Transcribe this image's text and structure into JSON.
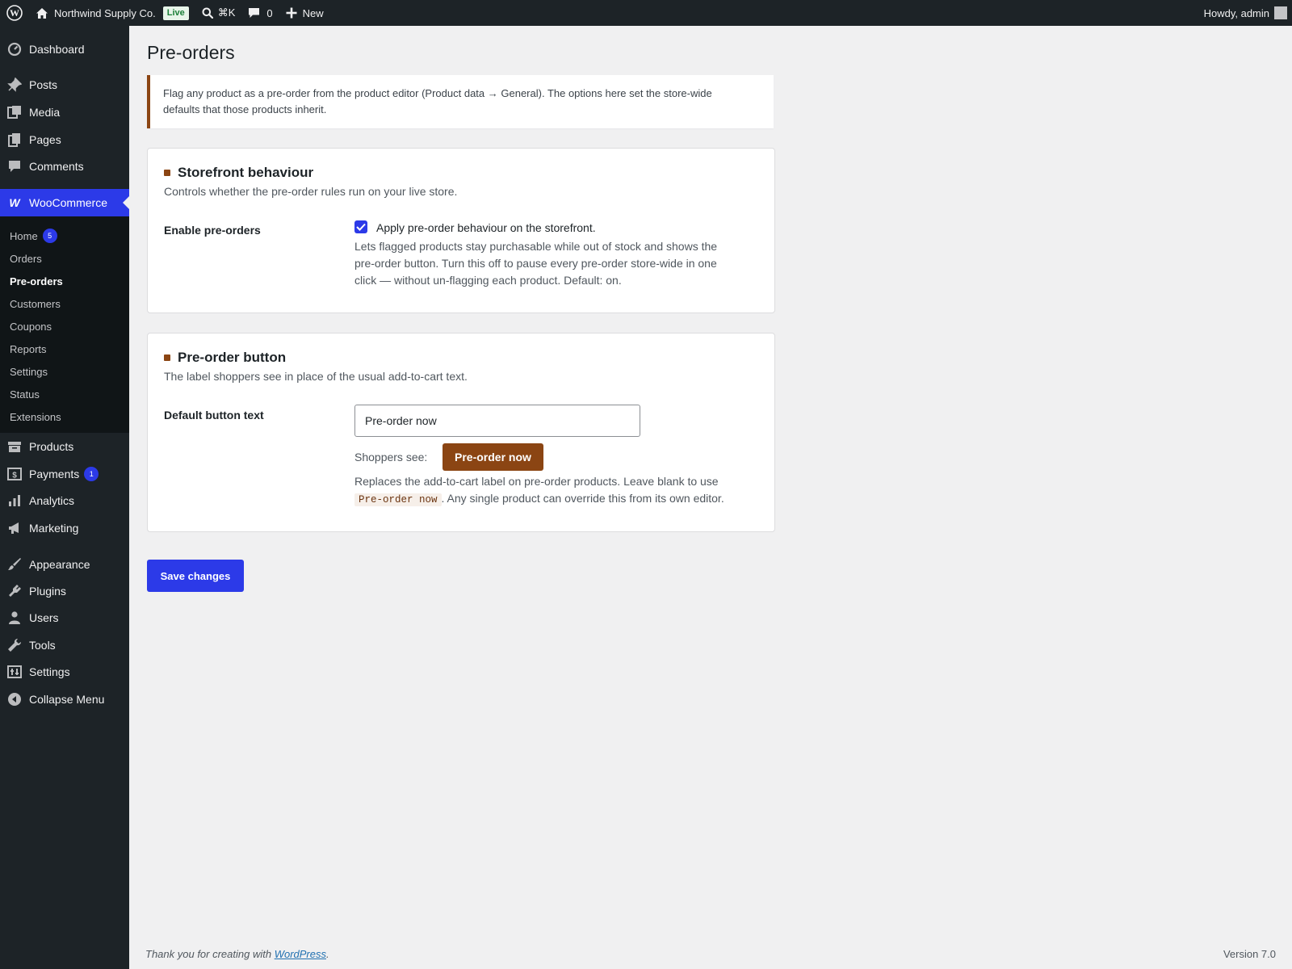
{
  "adminbar": {
    "site_name": "Northwind Supply Co.",
    "live_badge": "Live",
    "search_shortcut": "⌘K",
    "comments_count": "0",
    "new_label": "New",
    "greeting": "Howdy, admin"
  },
  "sidebar": {
    "items": [
      {
        "label": "Dashboard",
        "icon": "dashboard-icon"
      },
      {
        "label": "Posts",
        "icon": "pin-icon"
      },
      {
        "label": "Media",
        "icon": "media-icon"
      },
      {
        "label": "Pages",
        "icon": "pages-icon"
      },
      {
        "label": "Comments",
        "icon": "comment-icon"
      },
      {
        "label": "WooCommerce",
        "icon": "woocommerce-icon"
      },
      {
        "label": "Products",
        "icon": "archive-icon"
      },
      {
        "label": "Payments",
        "icon": "payments-icon",
        "badge": "1"
      },
      {
        "label": "Analytics",
        "icon": "chart-bar-icon"
      },
      {
        "label": "Marketing",
        "icon": "megaphone-icon"
      },
      {
        "label": "Appearance",
        "icon": "brush-icon"
      },
      {
        "label": "Plugins",
        "icon": "plugin-icon"
      },
      {
        "label": "Users",
        "icon": "user-icon"
      },
      {
        "label": "Tools",
        "icon": "wrench-icon"
      },
      {
        "label": "Settings",
        "icon": "settings-icon"
      },
      {
        "label": "Collapse Menu",
        "icon": "collapse-icon"
      }
    ],
    "woo_submenu": [
      {
        "label": "Home",
        "badge": "5"
      },
      {
        "label": "Orders"
      },
      {
        "label": "Pre-orders"
      },
      {
        "label": "Customers"
      },
      {
        "label": "Coupons"
      },
      {
        "label": "Reports"
      },
      {
        "label": "Settings"
      },
      {
        "label": "Status"
      },
      {
        "label": "Extensions"
      }
    ]
  },
  "page": {
    "title": "Pre-orders",
    "notice_line1": "Flag any product as a pre-order from the product editor (Product data → General). The options here set the store-wide",
    "notice_line2": "defaults that those products inherit."
  },
  "storefront": {
    "title": "Storefront behaviour",
    "description": "Controls whether the pre-order rules run on your live store.",
    "field_label": "Enable pre-orders",
    "checkbox_label": "Apply pre-order behaviour on the storefront.",
    "checked": true,
    "help_line1": "Lets flagged products stay purchasable while out of stock and shows the",
    "help_line2": "pre-order button. Turn this off to pause every pre-order store-wide in one",
    "help_line3": "click — without un-flagging each product. Default: on."
  },
  "button_section": {
    "title": "Pre-order button",
    "description": "The label shoppers see in place of the usual add-to-cart text.",
    "field_label": "Default button text",
    "input_value": "Pre-order now",
    "preview_label": "Shoppers see:",
    "preview_button": "Pre-order now",
    "help_line1": "Replaces the add-to-cart label on pre-order products. Leave blank to use",
    "help_code": "Pre-order now",
    "help_line2_rest": ". Any single product can override this from its own editor."
  },
  "actions": {
    "save_label": "Save changes"
  },
  "footer": {
    "thanks_prefix": "Thank you for creating with ",
    "wordpress_link": "WordPress",
    "thanks_suffix": ".",
    "version": "Version 7.0"
  },
  "colors": {
    "accent": "#2c3ae8",
    "brand_brown": "#8b4513",
    "adminbar_bg": "#1d2327"
  }
}
